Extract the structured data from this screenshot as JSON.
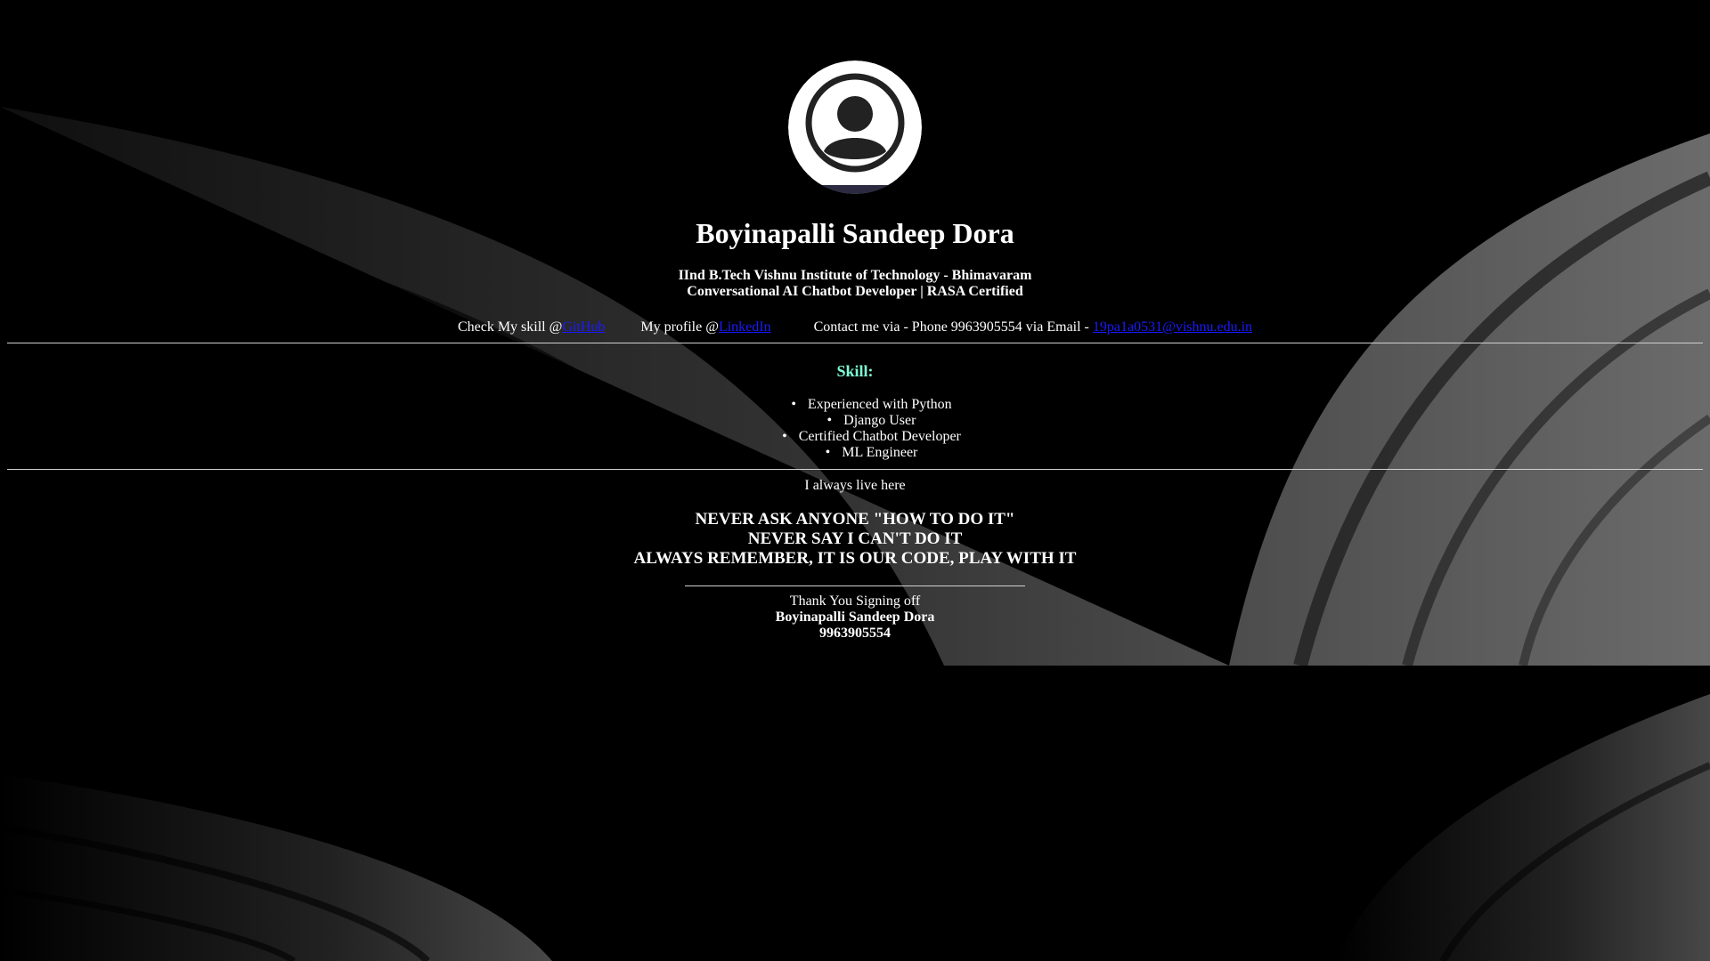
{
  "profile": {
    "name": "Boyinapalli Sandeep Dora",
    "subtitle_line1": "IInd B.Tech Vishnu Institute of Technology - Bhimavaram",
    "subtitle_line2": "Conversational AI Chatbot Developer | RASA Certified"
  },
  "contact": {
    "skill_prefix": "Check My skill @",
    "github_label": "GitHub",
    "profile_prefix": "My profile @",
    "linkedin_label": "LinkedIn",
    "contact_prefix": "Contact me via - Phone 9963905554 via Email - ",
    "email": "19pa1a0531@vishnu.edu.in"
  },
  "skills": {
    "title": "Skill:",
    "items": [
      "Experienced with Python",
      "Django User",
      "Certified Chatbot Developer",
      "ML Engineer"
    ]
  },
  "motto": {
    "intro": "I always live here",
    "lines": [
      "NEVER ASK ANYONE \"HOW TO DO IT\"",
      "NEVER SAY I CAN'T DO IT",
      "ALWAYS REMEMBER, IT IS OUR CODE, PLAY WITH IT"
    ]
  },
  "signoff": {
    "thanks": "Thank You Signing off",
    "name": "Boyinapalli Sandeep Dora",
    "phone": "9963905554"
  },
  "colors": {
    "background": "#000000",
    "text": "#ffffff",
    "skill_title": "#7fffd4",
    "link": "#1a1aff"
  }
}
